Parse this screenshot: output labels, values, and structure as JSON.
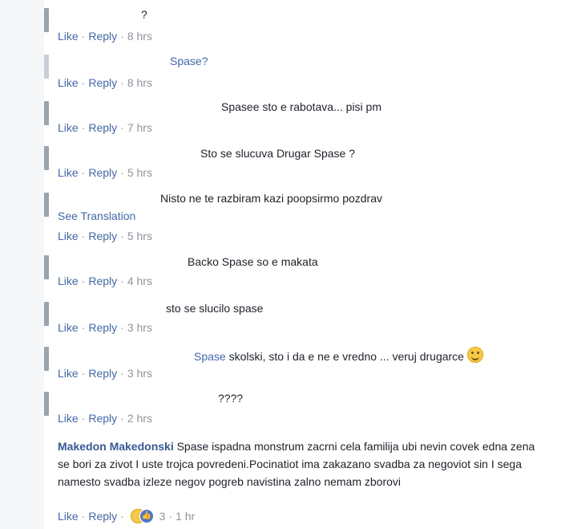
{
  "actions": {
    "like": "Like",
    "reply": "Reply",
    "sep": "·",
    "see_translation": "See Translation"
  },
  "comments": [
    {
      "text": "?",
      "time": "8 hrs"
    },
    {
      "text": "Spase?",
      "time": "8 hrs"
    },
    {
      "text": "Spasee sto e rabotava... pisi pm",
      "time": "7 hrs"
    },
    {
      "text": "Sto se slucuva Drugar Spase ?",
      "time": "5 hrs"
    },
    {
      "text": "Nisto ne te razbiram kazi poopsirmo pozdrav",
      "time": "5 hrs"
    },
    {
      "text": "Backo Spase so e makata",
      "time": "4 hrs"
    },
    {
      "text": "sto se slucilo spase",
      "time": "3 hrs"
    },
    {
      "mention": "Spase",
      "text": "skolski, sto i da e ne e vredno ... veruj drugarce",
      "time": "3 hrs"
    },
    {
      "text": "????",
      "time": "2 hrs"
    },
    {
      "author": "Makedon Makedonski",
      "text": "Spase ispadna monstrum zacrni cela familija ubi nevin covek edna zena se bori za zivot I uste trojca povredeni.Pocinatiot ima zakazano svadba za negoviot sin I sega namesto svadba izleze negov pogreb navistina zalno nemam zborovi",
      "reactions": "3",
      "time": "1 hr"
    }
  ],
  "colors": {
    "link": "#4267b2",
    "author": "#365899",
    "meta": "#90949c",
    "text": "#1d2129"
  }
}
